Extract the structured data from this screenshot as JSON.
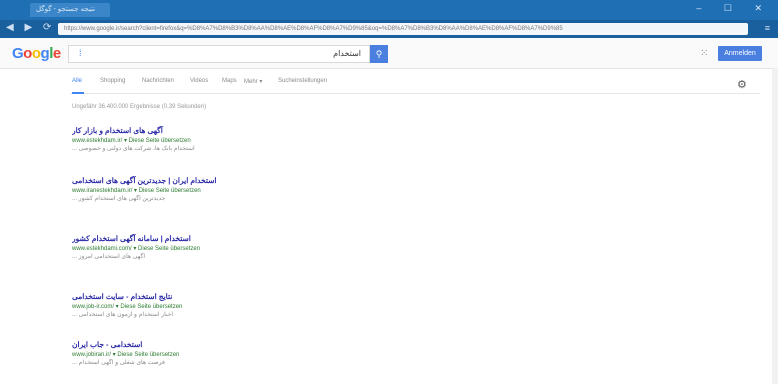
{
  "browser": {
    "tab_title": "نتیجه جستجو - گوگل",
    "window_controls": "‒ ☐ ✕",
    "nav_glyphs": "◀ ▶ ⟳",
    "address": "https://www.google.ir/search?client=firefox&q=%D8%A7%D8%B3%D8%AA%D8%AE%D8%AF%D8%A7%D9%85&oq=%D8%A7%D8%B3%D8%AA%D8%AE%D8%AF%D8%A7%D9%85",
    "menu_glyph": "≡"
  },
  "header": {
    "logo_letters": [
      {
        "ch": "G",
        "color": "#4285f4"
      },
      {
        "ch": "o",
        "color": "#ea4335"
      },
      {
        "ch": "o",
        "color": "#fbbc05"
      },
      {
        "ch": "g",
        "color": "#4285f4"
      },
      {
        "ch": "l",
        "color": "#34a853"
      },
      {
        "ch": "e",
        "color": "#ea4335"
      }
    ],
    "mic_glyph": "⁞",
    "query": "استخدام",
    "search_glyph": "⚲",
    "apps_glyph": "⁙",
    "signin": "Anmelden"
  },
  "tabs": [
    {
      "label": "Alle",
      "active": true
    },
    {
      "label": "Shopping",
      "active": false
    },
    {
      "label": "Nachrichten",
      "active": false
    },
    {
      "label": "Videos",
      "active": false
    },
    {
      "label": "Maps",
      "active": false
    },
    {
      "label": "Mehr ▾",
      "active": false
    },
    {
      "label": "Sucheinstellungen",
      "active": false
    }
  ],
  "gear_glyph": "⚙",
  "stats": "Ungefähr 36.400.000 Ergebnisse (0,39 Sekunden)",
  "results": [
    {
      "title": "آگهی های استخدام و بازار کار",
      "url": "www.estekhdam.ir/ ▾ Diese Seite übersetzen",
      "snippet": "استخدام بانک ها، شرکت های دولتی و خصوصی ..."
    },
    {
      "title": "استخدام ایران | جدیدترین آگهی های استخدامی",
      "url": "www.iranestekhdam.ir/ ▾ Diese Seite übersetzen",
      "snippet": "جدیدترین آگهی های استخدام کشور ..."
    },
    {
      "title": "استخدام | سامانه آگهی استخدام کشور",
      "url": "www.estekhdami.com/ ▾ Diese Seite übersetzen",
      "snippet": "آگهی های استخدامی امروز ..."
    },
    {
      "title": "نتایج استخدام - سایت استخدامی",
      "url": "www.job-ir.com/ ▾ Diese Seite übersetzen",
      "snippet": "اخبار استخدام و آزمون های استخدامی ..."
    },
    {
      "title": "استخدامی - جاب ایران",
      "url": "www.jobiran.ir/ ▾ Diese Seite übersetzen",
      "snippet": "فرصت های شغلی و آگهی استخدام ..."
    }
  ]
}
